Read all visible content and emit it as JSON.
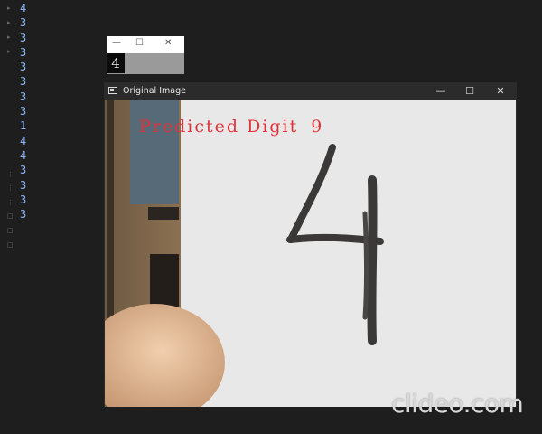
{
  "console": {
    "lines": [
      "4",
      "3",
      "3",
      "3",
      "3",
      "3",
      "3",
      "3",
      "1",
      "4",
      "4",
      "3",
      "3",
      "3",
      "3"
    ]
  },
  "thumbnail_window": {
    "minimize": "—",
    "maximize": "☐",
    "close": "✕",
    "digit": "4"
  },
  "main_window": {
    "title": "Original Image",
    "minimize": "—",
    "maximize": "☐",
    "close": "✕"
  },
  "overlay": {
    "label": "Predicted Digit",
    "value": "9"
  },
  "handwritten_digit": "4",
  "watermark": "clideo.com",
  "colors": {
    "background": "#1e1e1e",
    "console_text": "#8ab4f8",
    "prediction_text": "#e2323a",
    "titlebar": "#2b2b2b"
  }
}
